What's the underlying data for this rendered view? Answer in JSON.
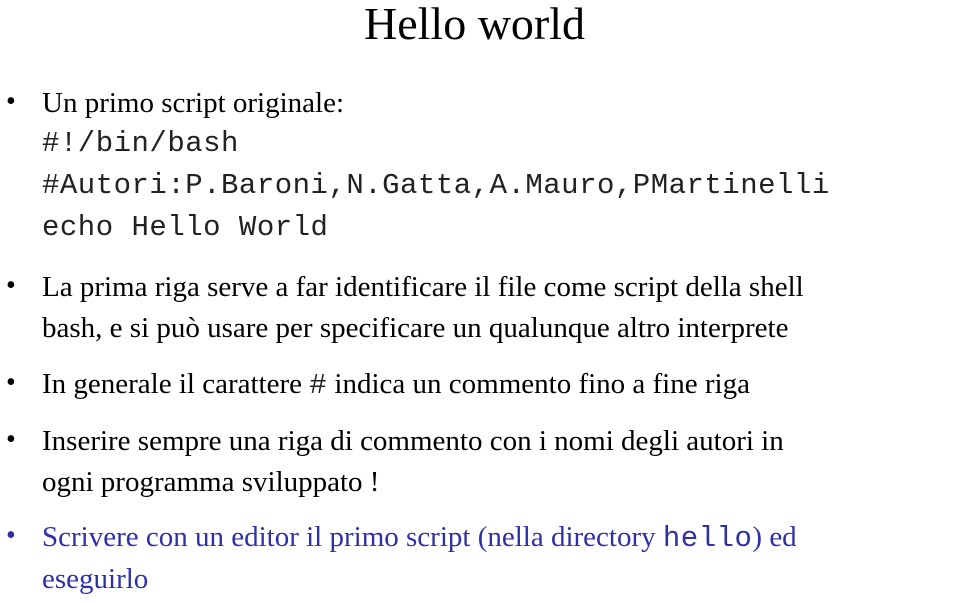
{
  "slide": {
    "title": "Hello world",
    "accent_color": "#2f2fa8",
    "b1": {
      "text": "Un primo script originale:",
      "code": [
        "#!/bin/bash",
        "#Autori:P.Baroni,N.Gatta,A.Mauro,PMartinelli",
        "echo Hello World"
      ]
    },
    "b2": [
      "La prima riga serve a far identificare il file come script della shell",
      "bash, e si può usare per specificare un qualunque altro interprete"
    ],
    "b3": {
      "pre": "In generale il carattere ",
      "code": "#",
      "post": " indica un commento fino a fine riga"
    },
    "b4": [
      "Inserire sempre una riga di commento con i nomi degli autori in",
      "ogni programma sviluppato !"
    ],
    "b5": {
      "pre": "Scrivere con un editor il primo script (nella directory ",
      "code": "hello",
      "post": ") ed",
      "line2": "eseguirlo"
    },
    "bullet_glyph": "•"
  }
}
